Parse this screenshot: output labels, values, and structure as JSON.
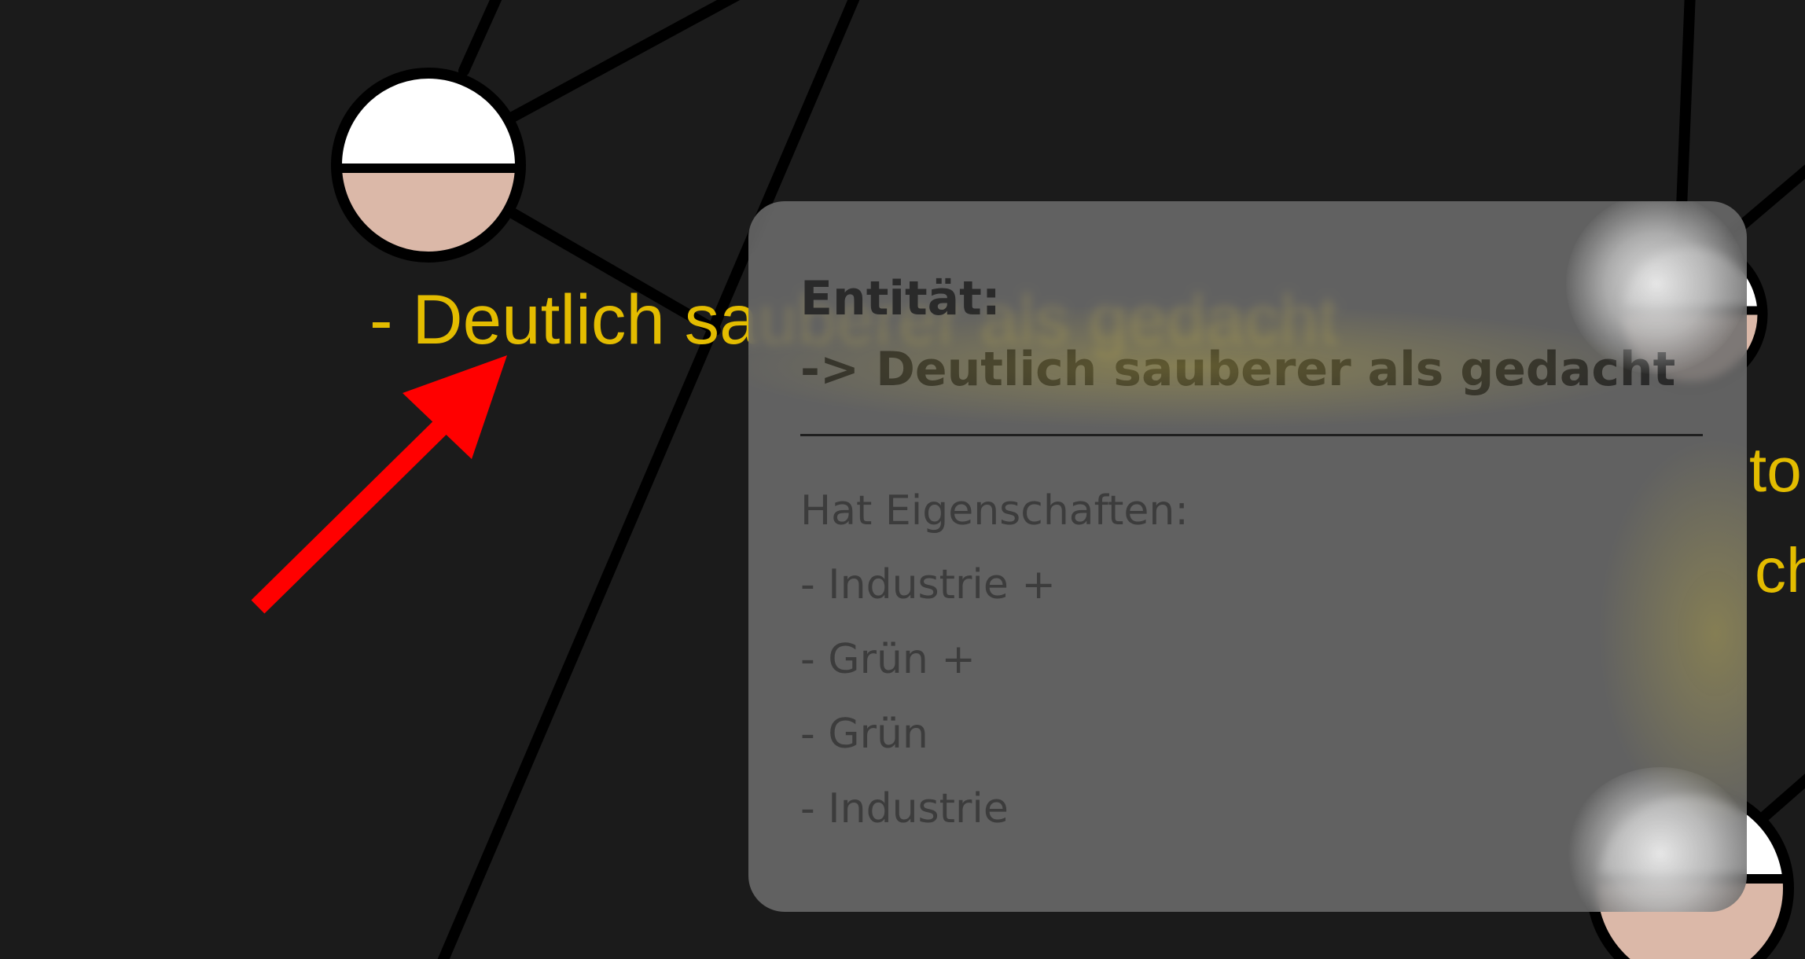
{
  "graph": {
    "node_label": "- Deutlich sauberer als gedacht",
    "clipped_label_1": "to",
    "clipped_label_2": "ch"
  },
  "tooltip": {
    "heading": "Entität:",
    "entity": "-> Deutlich sauberer als gedacht",
    "section_title": "Hat Eigenschaften:",
    "properties": [
      "- Industrie +",
      "- Grün +",
      "- Grün",
      "- Industrie"
    ]
  },
  "annotation": {
    "arrow_color": "#ff0000"
  },
  "colors": {
    "background": "#1b1b1b",
    "label": "#e3bc00",
    "node_top": "#ffffff",
    "node_bottom": "#dbb8a8"
  }
}
